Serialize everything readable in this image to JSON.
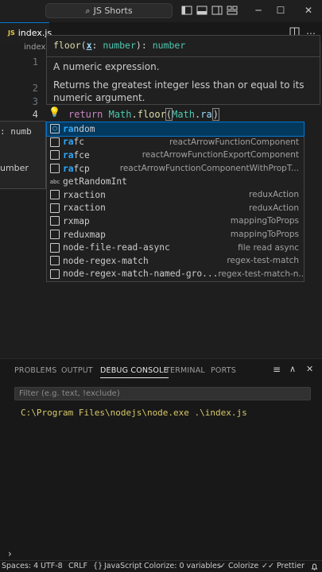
{
  "titlebar": {
    "search_text": "JS Shorts",
    "icons": [
      "search-icon",
      "toggle-sidebar-icon",
      "toggle-panel-icon",
      "toggle-secondary-sidebar-icon",
      "customize-layout-icon"
    ],
    "window_controls": {
      "minimize": "─",
      "maximize": "☐",
      "close": "✕"
    }
  },
  "tabs": {
    "active_tab": "index.js",
    "badge": "JS"
  },
  "breadcrumb": "index.js",
  "editor": {
    "line_numbers": [
      "1",
      "2",
      "3",
      "4"
    ],
    "active_line": "4",
    "line4": {
      "keyword": "return",
      "obj1": "Math",
      "dot1": ".",
      "method": "floor",
      "paren": "(",
      "obj2": "Math",
      "dot2": ".",
      "typed": "ra",
      "close": ")"
    }
  },
  "signature_popup": {
    "name": "floor",
    "param_open": "(",
    "param_name": "x",
    "param_sep": ": ",
    "param_type": "number",
    "param_close": ")",
    "return_sep": ": ",
    "return_type": "number",
    "param_doc": "A numeric expression.",
    "doc": "Returns the greatest integer less than or equal to its numeric argument."
  },
  "left_peek": {
    "line1": ": numb",
    "line2": "umber"
  },
  "suggestions": [
    {
      "match": "ra",
      "rest": "ndom",
      "detail": "",
      "icon": "cube-icon",
      "icon_glyph": "⬡",
      "selected": true
    },
    {
      "match": "ra",
      "rest": "fc",
      "detail": "reactArrowFunctionComponent",
      "icon": "snippet-icon",
      "icon_glyph": "",
      "selected": false
    },
    {
      "match": "ra",
      "rest": "fce",
      "detail": "reactArrowFunctionExportComponent",
      "icon": "snippet-icon",
      "icon_glyph": "",
      "selected": false
    },
    {
      "match": "ra",
      "rest": "fcp",
      "detail": "reactArrowFunctionComponentWithPropT...",
      "icon": "snippet-icon",
      "icon_glyph": "",
      "selected": false
    },
    {
      "match": "",
      "rest": "getRandomInt",
      "detail": "",
      "icon": "abc-icon",
      "icon_glyph": "abc",
      "selected": false
    },
    {
      "match": "",
      "rest": "rxaction",
      "detail": "reduxAction",
      "icon": "snippet-icon",
      "icon_glyph": "",
      "selected": false
    },
    {
      "match": "",
      "rest": "rxaction",
      "detail": "reduxAction",
      "icon": "snippet-icon",
      "icon_glyph": "",
      "selected": false
    },
    {
      "match": "",
      "rest": "rxmap",
      "detail": "mappingToProps",
      "icon": "snippet-icon",
      "icon_glyph": "",
      "selected": false
    },
    {
      "match": "",
      "rest": "reduxmap",
      "detail": "mappingToProps",
      "icon": "snippet-icon",
      "icon_glyph": "",
      "selected": false
    },
    {
      "match": "",
      "rest": "node-file-read-async",
      "detail": "file read async",
      "icon": "snippet-icon",
      "icon_glyph": "",
      "selected": false
    },
    {
      "match": "",
      "rest": "node-regex-match",
      "detail": "regex-test-match",
      "icon": "snippet-icon",
      "icon_glyph": "",
      "selected": false
    },
    {
      "match": "",
      "rest": "node-regex-match-named-gro...",
      "detail": "regex-test-match-n...",
      "icon": "snippet-icon",
      "icon_glyph": "",
      "selected": false
    }
  ],
  "panel": {
    "tabs": [
      "PROBLEMS",
      "OUTPUT",
      "DEBUG CONSOLE",
      "TERMINAL",
      "PORTS"
    ],
    "active_tab": "DEBUG CONSOLE",
    "filter_placeholder": "Filter (e.g. text, !exclude)",
    "console_output": "C:\\Program Files\\nodejs\\node.exe .\\index.js",
    "prompt": "›",
    "controls": {
      "filter_icon": "≡",
      "maximize_icon": "∧",
      "close_icon": "✕"
    }
  },
  "statusbar": {
    "spaces": "Spaces: 4",
    "encoding": "UTF-8",
    "eol": "CRLF",
    "language_braces": "{}",
    "language": "JavaScript",
    "colorize": "Colorize: 0 variables",
    "colorize_check": "✓ Colorize",
    "prettier": "✓✓ Prettier",
    "bell": "bell-icon"
  },
  "colors": {
    "accent": "#0078d4",
    "suggest_highlight": "#2aaaff",
    "keyword": "#c586c0",
    "type": "#4ec9b0",
    "function": "#dcdcaa",
    "console_text": "#d8c86a"
  }
}
